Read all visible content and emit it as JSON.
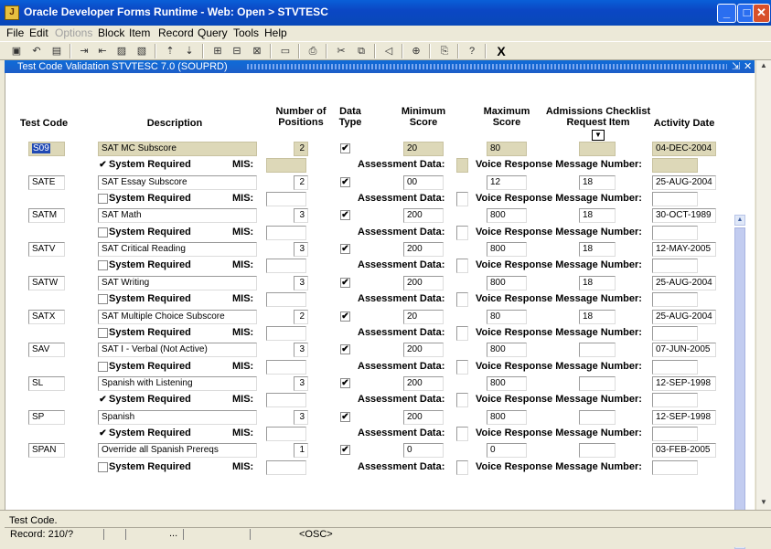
{
  "window": {
    "title": "Oracle Developer Forms Runtime - Web:  Open > STVTESC",
    "minimize": "_",
    "maximize": "□",
    "close": "✕"
  },
  "menu": [
    "File",
    "Edit",
    "Options",
    "Block",
    "Item",
    "Record",
    "Query",
    "Tools",
    "Help"
  ],
  "toolbar": {
    "exit_label": "X"
  },
  "form": {
    "title": "Test Code Validation  STVTESC  7.0  (SOUPRD)",
    "min_ctrl": "⇲",
    "close_ctrl": "✕"
  },
  "headers": {
    "test_code": "Test Code",
    "description": "Description",
    "positions": [
      "Number of",
      "Positions"
    ],
    "data_type": [
      "Data",
      "Type"
    ],
    "min_score": [
      "Minimum",
      "Score"
    ],
    "max_score": [
      "Maximum",
      "Score"
    ],
    "checklist": [
      "Admissions Checklist",
      "Request Item"
    ],
    "activity_date": "Activity Date"
  },
  "labels": {
    "system_required": "System Required",
    "mis": "MIS:",
    "assessment": "Assessment Data:",
    "voice": "Voice Response Message Number:"
  },
  "rows": [
    {
      "code": "S09",
      "desc": "SAT MC Subscore",
      "pos": "2",
      "type_checked": true,
      "min": "20",
      "max": "80",
      "item": "",
      "date": "04-DEC-2004",
      "sysreq": true
    },
    {
      "code": "SATE",
      "desc": "SAT Essay Subscore",
      "pos": "2",
      "type_checked": true,
      "min": "00",
      "max": "12",
      "item": "18",
      "date": "25-AUG-2004",
      "sysreq": false
    },
    {
      "code": "SATM",
      "desc": "SAT Math",
      "pos": "3",
      "type_checked": true,
      "min": "200",
      "max": "800",
      "item": "18",
      "date": "30-OCT-1989",
      "sysreq": false
    },
    {
      "code": "SATV",
      "desc": "SAT Critical Reading",
      "pos": "3",
      "type_checked": true,
      "min": "200",
      "max": "800",
      "item": "18",
      "date": "12-MAY-2005",
      "sysreq": false
    },
    {
      "code": "SATW",
      "desc": "SAT Writing",
      "pos": "3",
      "type_checked": true,
      "min": "200",
      "max": "800",
      "item": "18",
      "date": "25-AUG-2004",
      "sysreq": false
    },
    {
      "code": "SATX",
      "desc": "SAT Multiple Choice Subscore",
      "pos": "2",
      "type_checked": true,
      "min": "20",
      "max": "80",
      "item": "18",
      "date": "25-AUG-2004",
      "sysreq": false
    },
    {
      "code": "SAV",
      "desc": "SAT I - Verbal (Not Active)",
      "pos": "3",
      "type_checked": true,
      "min": "200",
      "max": "800",
      "item": "",
      "date": "07-JUN-2005",
      "sysreq": false
    },
    {
      "code": "SL",
      "desc": "Spanish with Listening",
      "pos": "3",
      "type_checked": true,
      "min": "200",
      "max": "800",
      "item": "",
      "date": "12-SEP-1998",
      "sysreq": true
    },
    {
      "code": "SP",
      "desc": "Spanish",
      "pos": "3",
      "type_checked": true,
      "min": "200",
      "max": "800",
      "item": "",
      "date": "12-SEP-1998",
      "sysreq": true
    },
    {
      "code": "SPAN",
      "desc": "Override all Spanish Prereqs",
      "pos": "1",
      "type_checked": true,
      "min": "0",
      "max": "0",
      "item": "",
      "date": "03-FEB-2005",
      "sysreq": false
    }
  ],
  "status": {
    "message": "Test Code.",
    "record": "Record: 210/?",
    "dots": "...",
    "osc": "<OSC>"
  }
}
